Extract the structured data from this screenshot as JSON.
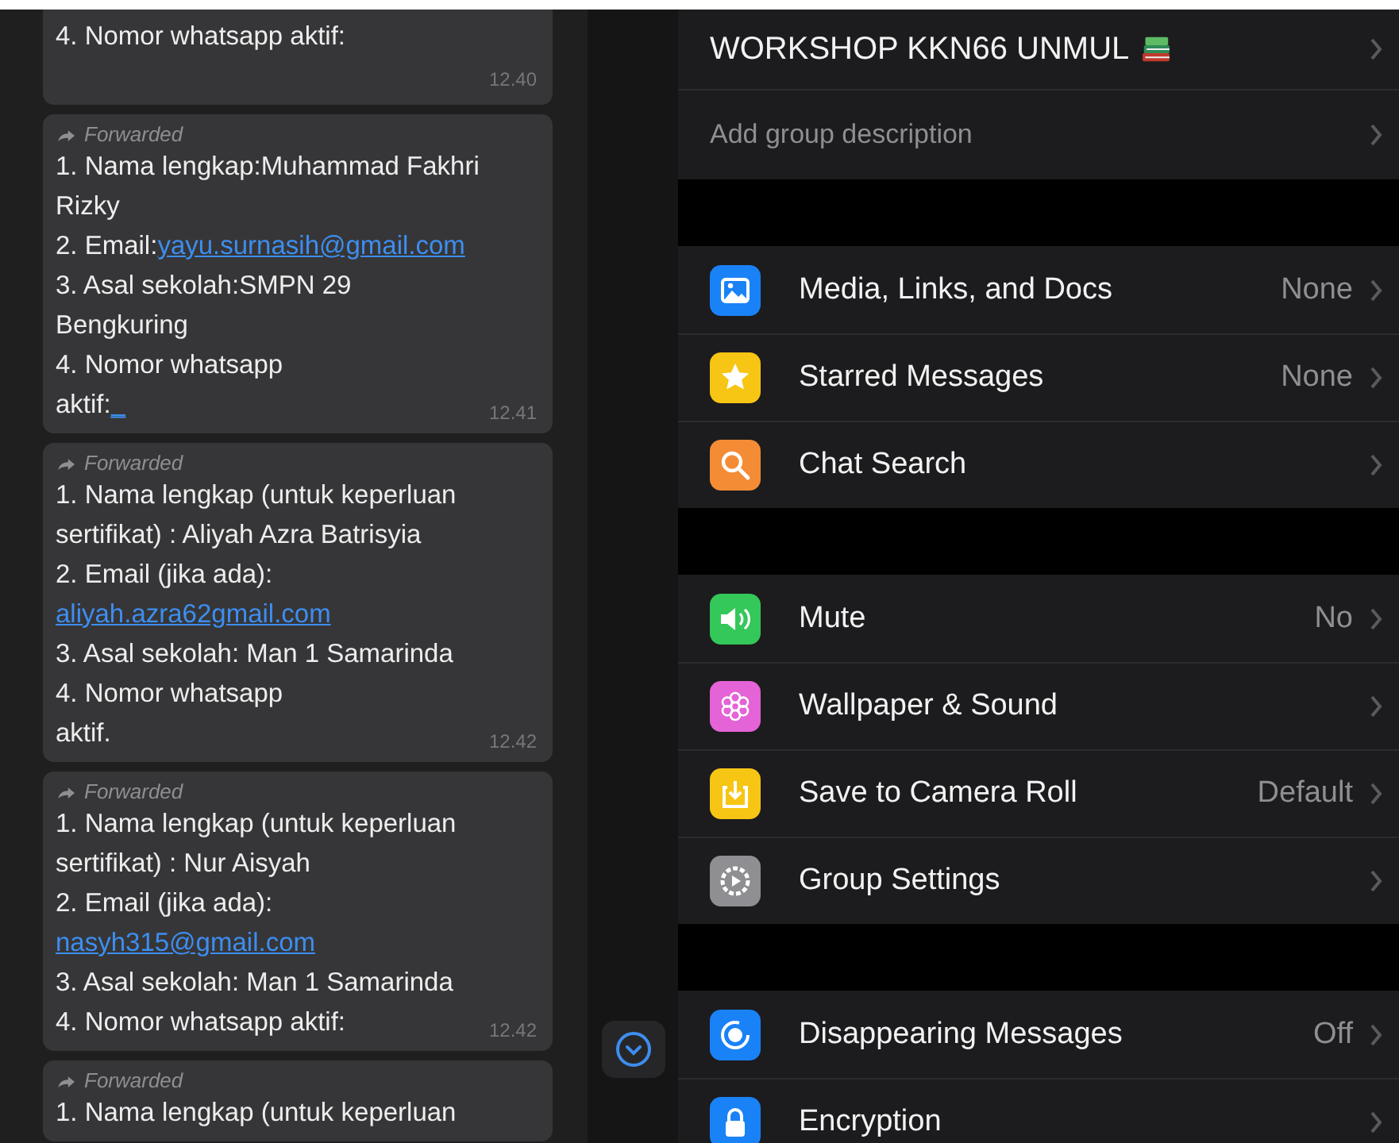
{
  "chat": {
    "messages": [
      {
        "forwarded": false,
        "lines": [
          [
            {
              "text": "4. Nomor whatsapp aktif:"
            }
          ]
        ],
        "time": "12.40"
      },
      {
        "forwarded": true,
        "forward_label": "Forwarded",
        "lines": [
          [
            {
              "text": "1. Nama lengkap:Muhammad Fakhri"
            }
          ],
          [
            {
              "text": "Rizky"
            }
          ],
          [
            {
              "text": "2. Email:"
            },
            {
              "text": "yayu.surnasih@gmail.com",
              "link": true
            }
          ],
          [
            {
              "text": "3. Asal sekolah:SMPN 29"
            }
          ],
          [
            {
              "text": "Bengkuring"
            }
          ],
          [
            {
              "text": "4. Nomor whatsapp"
            }
          ],
          [
            {
              "text": "aktif:"
            },
            {
              "text": "_",
              "link": true
            }
          ]
        ],
        "time": "12.41"
      },
      {
        "forwarded": true,
        "forward_label": "Forwarded",
        "lines": [
          [
            {
              "text": "1. Nama lengkap (untuk keperluan"
            }
          ],
          [
            {
              "text": "sertifikat) : Aliyah Azra Batrisyia"
            }
          ],
          [
            {
              "text": "2. Email (jika ada):"
            }
          ],
          [
            {
              "text": "aliyah.azra62gmail.com",
              "link": true
            }
          ],
          [
            {
              "text": "3. Asal sekolah: Man 1 Samarinda"
            }
          ],
          [
            {
              "text": "4. Nomor whatsapp"
            }
          ],
          [
            {
              "text": "aktif."
            }
          ]
        ],
        "time": "12.42"
      },
      {
        "forwarded": true,
        "forward_label": "Forwarded",
        "lines": [
          [
            {
              "text": "1. Nama lengkap (untuk keperluan"
            }
          ],
          [
            {
              "text": "sertifikat) : Nur Aisyah"
            }
          ],
          [
            {
              "text": "2. Email (jika ada):"
            }
          ],
          [
            {
              "text": "nasyh315@gmail.com",
              "link": true
            }
          ],
          [
            {
              "text": "3. Asal sekolah: Man 1 Samarinda"
            }
          ],
          [
            {
              "text": "4. Nomor whatsapp aktif:"
            }
          ]
        ],
        "time": "12.42"
      },
      {
        "forwarded": true,
        "forward_label": "Forwarded",
        "lines": [
          [
            {
              "text": "1. Nama lengkap (untuk keperluan"
            }
          ]
        ]
      }
    ]
  },
  "group_info": {
    "title": "WORKSHOP KKN66 UNMUL",
    "description_placeholder": "Add group description",
    "sections": [
      [
        {
          "label": "Media, Links, and Docs",
          "value": "None"
        },
        {
          "label": "Starred Messages",
          "value": "None"
        },
        {
          "label": "Chat Search"
        }
      ],
      [
        {
          "label": "Mute",
          "value": "No"
        },
        {
          "label": "Wallpaper & Sound"
        },
        {
          "label": "Save to Camera Roll",
          "value": "Default"
        },
        {
          "label": "Group Settings"
        }
      ],
      [
        {
          "label": "Disappearing Messages",
          "value": "Off"
        },
        {
          "label": "Encryption"
        }
      ]
    ]
  }
}
